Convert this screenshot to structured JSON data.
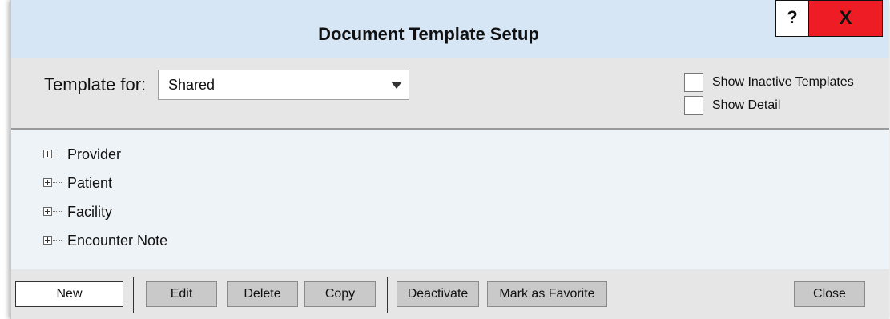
{
  "window": {
    "title": "Document Template Setup"
  },
  "titlebar": {
    "help_label": "?",
    "close_label": "X"
  },
  "filter": {
    "template_for_label": "Template for:",
    "template_for_value": "Shared",
    "show_inactive_label": "Show Inactive Templates",
    "show_detail_label": "Show Detail"
  },
  "tree": {
    "items": [
      "Provider",
      "Patient",
      "Facility",
      "Encounter Note"
    ]
  },
  "toolbar": {
    "new": "New",
    "edit": "Edit",
    "delete": "Delete",
    "copy": "Copy",
    "deactivate": "Deactivate",
    "favorite": "Mark as Favorite",
    "close": "Close"
  },
  "colors": {
    "titlebar_bg": "#d6e6f5",
    "close_bg": "#ee1c24",
    "panel_bg": "#e6e6e6",
    "tree_bg": "#eef3f8"
  }
}
